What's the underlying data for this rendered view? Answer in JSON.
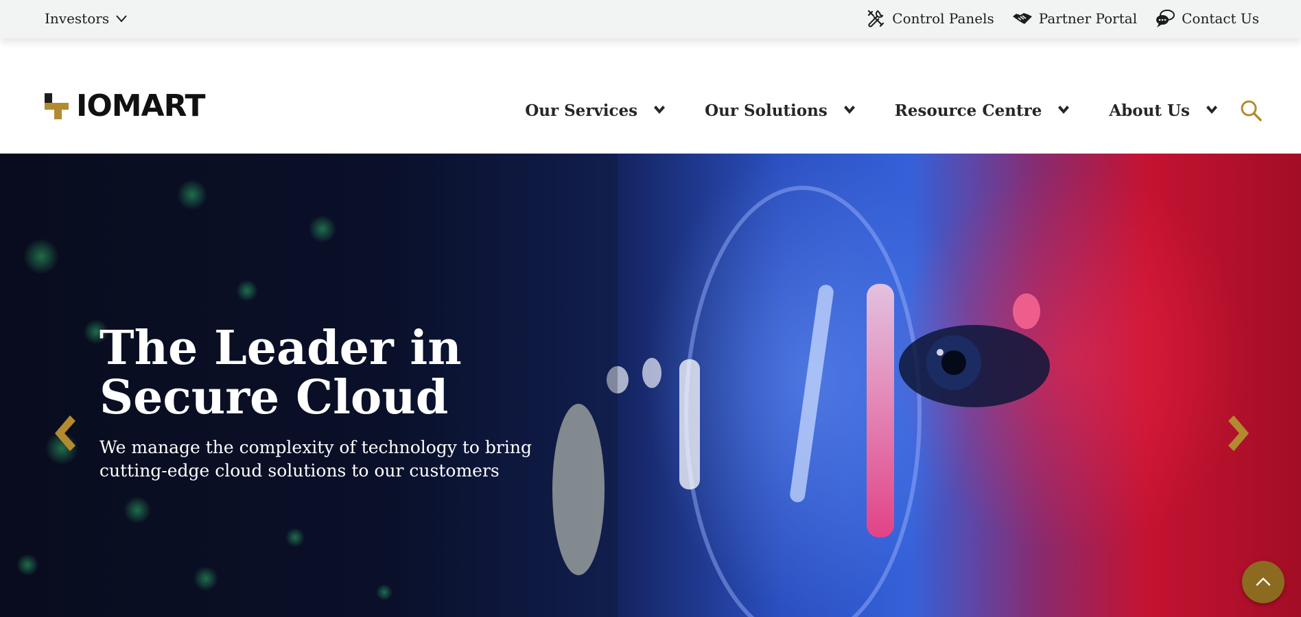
{
  "topbar": {
    "investors_label": "Investors",
    "links": [
      {
        "label": "Control Panels",
        "icon": "tools-icon"
      },
      {
        "label": "Partner Portal",
        "icon": "handshake-icon"
      },
      {
        "label": "Contact Us",
        "icon": "chat-icon"
      }
    ]
  },
  "header": {
    "logo_text": "IOMART",
    "nav": [
      {
        "label": "Our Services"
      },
      {
        "label": "Our Solutions"
      },
      {
        "label": "Resource Centre"
      },
      {
        "label": "About Us"
      }
    ]
  },
  "hero": {
    "title_line1": "The Leader in",
    "title_line2": "Secure Cloud",
    "subtitle_line1": "We manage the complexity of technology to bring",
    "subtitle_line2": "cutting-edge cloud solutions to our customers"
  },
  "colors": {
    "accent_gold": "#b38a2f",
    "topbar_bg": "#f2f3f3",
    "hero_text": "#ffffff",
    "back_to_top_bg": "#8c6a1f"
  }
}
